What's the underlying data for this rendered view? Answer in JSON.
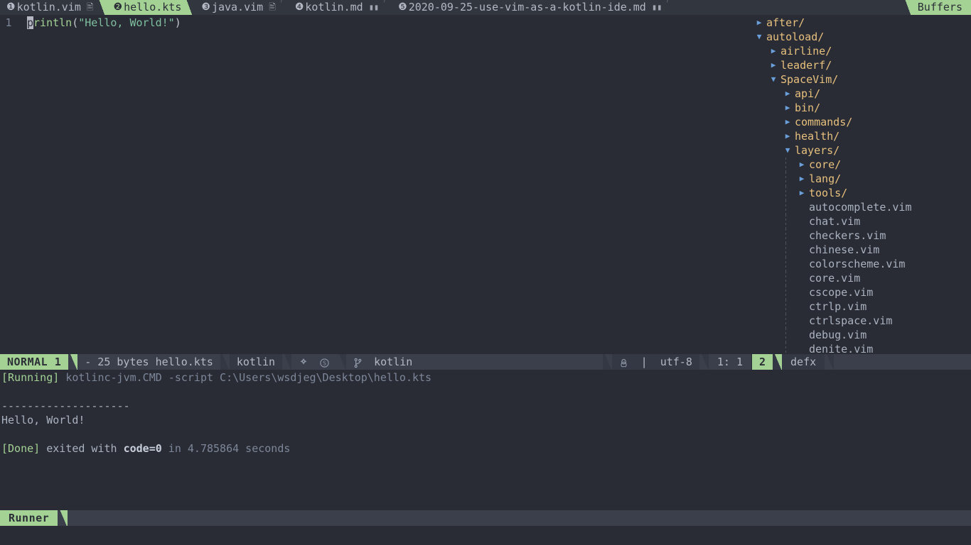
{
  "tabline": {
    "tabs": [
      {
        "index": "❶",
        "label": "kotlin.vim",
        "icon": "vim-file-icon",
        "active": false
      },
      {
        "index": "❷",
        "label": "hello.kts",
        "icon": "",
        "active": true
      },
      {
        "index": "❸",
        "label": "java.vim",
        "icon": "vim-file-icon",
        "active": false
      },
      {
        "index": "❹",
        "label": "kotlin.md",
        "icon": "markdown-file-icon",
        "active": false
      },
      {
        "index": "❺",
        "label": "2020-09-25-use-vim-as-a-kotlin-ide.md",
        "icon": "markdown-file-icon",
        "active": false
      }
    ],
    "buffers_label": "Buffers"
  },
  "editor": {
    "lines": [
      {
        "number": "1",
        "cursor_char": "p",
        "rest_fn": "rintln",
        "open_paren": "(",
        "string": "\"Hello, World!\"",
        "close_paren": ")"
      }
    ]
  },
  "filetree": {
    "rows": [
      {
        "depth": 0,
        "arrow": "closed",
        "name": "after/",
        "kind": "dir"
      },
      {
        "depth": 0,
        "arrow": "open",
        "name": "autoload/",
        "kind": "dir"
      },
      {
        "depth": 1,
        "arrow": "closed",
        "name": "airline/",
        "kind": "dir"
      },
      {
        "depth": 1,
        "arrow": "closed",
        "name": "leaderf/",
        "kind": "dir"
      },
      {
        "depth": 1,
        "arrow": "open",
        "name": "SpaceVim/",
        "kind": "dir"
      },
      {
        "depth": 2,
        "arrow": "closed",
        "name": "api/",
        "kind": "dir"
      },
      {
        "depth": 2,
        "arrow": "closed",
        "name": "bin/",
        "kind": "dir"
      },
      {
        "depth": 2,
        "arrow": "closed",
        "name": "commands/",
        "kind": "dir"
      },
      {
        "depth": 2,
        "arrow": "closed",
        "name": "health/",
        "kind": "dir"
      },
      {
        "depth": 2,
        "arrow": "open",
        "name": "layers/",
        "kind": "dir"
      },
      {
        "depth": 3,
        "arrow": "closed",
        "name": "core/",
        "kind": "dir"
      },
      {
        "depth": 3,
        "arrow": "closed",
        "name": "lang/",
        "kind": "dir"
      },
      {
        "depth": 3,
        "arrow": "closed",
        "name": "tools/",
        "kind": "dir"
      },
      {
        "depth": 3,
        "arrow": "none",
        "name": "autocomplete.vim",
        "kind": "file"
      },
      {
        "depth": 3,
        "arrow": "none",
        "name": "chat.vim",
        "kind": "file"
      },
      {
        "depth": 3,
        "arrow": "none",
        "name": "checkers.vim",
        "kind": "file"
      },
      {
        "depth": 3,
        "arrow": "none",
        "name": "chinese.vim",
        "kind": "file"
      },
      {
        "depth": 3,
        "arrow": "none",
        "name": "colorscheme.vim",
        "kind": "file"
      },
      {
        "depth": 3,
        "arrow": "none",
        "name": "core.vim",
        "kind": "file"
      },
      {
        "depth": 3,
        "arrow": "none",
        "name": "cscope.vim",
        "kind": "file"
      },
      {
        "depth": 3,
        "arrow": "none",
        "name": "ctrlp.vim",
        "kind": "file"
      },
      {
        "depth": 3,
        "arrow": "none",
        "name": "ctrlspace.vim",
        "kind": "file"
      },
      {
        "depth": 3,
        "arrow": "none",
        "name": "debug.vim",
        "kind": "file"
      },
      {
        "depth": 3,
        "arrow": "none",
        "name": "denite.vim",
        "kind": "file"
      }
    ]
  },
  "statusline": {
    "mode": "NORMAL 1",
    "file_info": "- 25 bytes hello.kts",
    "filetype": "kotlin",
    "vcs_icons": "gitgutter-icon scm-icon",
    "branch_icon": "git-branch-icon",
    "branch": "kotlin",
    "fileformat_icon": "linux-penguin-icon",
    "fileformat_sep": "|",
    "encoding": "utf-8",
    "position": "1:  1"
  },
  "statusline_right": {
    "window_number": "2",
    "name": "defx"
  },
  "runner": {
    "lines": [
      {
        "type": "running",
        "tag": "[Running]",
        "cmd": "kotlinc-jvm.CMD -script C:\\Users\\wsdjeg\\Desktop\\hello.kts"
      },
      {
        "type": "blank",
        "text": ""
      },
      {
        "type": "plain",
        "text": "--------------------"
      },
      {
        "type": "plain",
        "text": "Hello, World!"
      },
      {
        "type": "blank",
        "text": ""
      },
      {
        "type": "done",
        "tag": "[Done]",
        "mid": " exited with ",
        "code": "code=0",
        "tail": " in 4.785864 seconds"
      }
    ],
    "status_label": "Runner"
  },
  "colors": {
    "accent_green": "#a3d294",
    "background": "#292c35",
    "statusline_bg": "#3a3f4b",
    "tabline_bg": "#32363e",
    "dir_color": "#e8c07d",
    "file_color": "#aab2c0",
    "arrow_color": "#6a9fda"
  }
}
